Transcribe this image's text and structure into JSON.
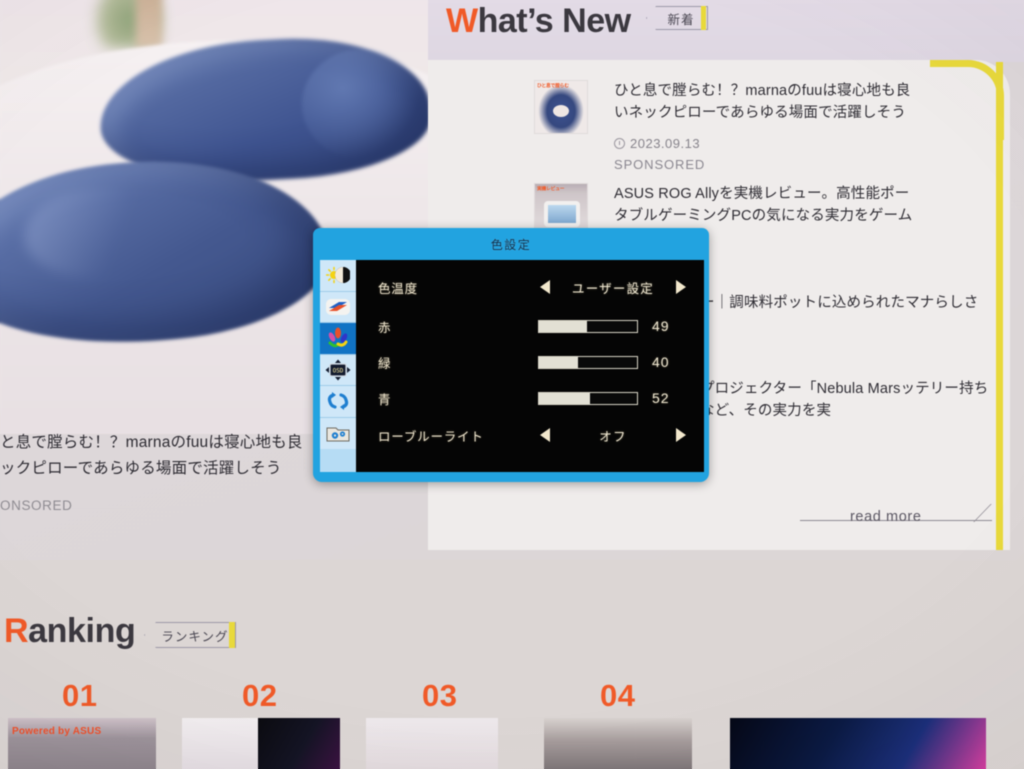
{
  "webpage": {
    "whats_new": {
      "title_accent": "W",
      "title_rest": "hat’s New",
      "badge": "新着",
      "articles": [
        {
          "title": "ひと息で膛らむ！？marnaのfuuは寝心地も良いネックピローであらゆる場面で活躍しそう",
          "date": "2023.09.13",
          "sponsored": "SPONSORED",
          "thumb_label": "ひと息で膛らむ",
          "thumb_kind": "pillow"
        },
        {
          "title": "ASUS ROG Allyを実機レビュー。高性能ポータブルゲーミングPCの気になる実力をゲームで検証",
          "date": "",
          "sponsored": "",
          "thumb_label": "実機レビュー",
          "thumb_kind": "ally"
        },
        {
          "title": "ー｜調味料ポットに込められたマナらしさ",
          "date": "",
          "sponsored": "",
          "thumb_label": "",
          "thumb_kind": "none"
        },
        {
          "title": "プロジェクター「Nebula Marsッテリー持ちなど、その実力を実",
          "date": "",
          "sponsored": "",
          "thumb_label": "",
          "thumb_kind": "none"
        }
      ],
      "read_more": "read more"
    },
    "left_article": {
      "line1": "と息で膛らむ！？marnaのfuuは寝心地も良",
      "line2": "ックピローであらゆる場面で活躍しそう",
      "sponsored": "ONSORED"
    },
    "ranking": {
      "title_accent": "R",
      "title_rest": "anking",
      "badge": "ランキング",
      "items": [
        {
          "number": "01",
          "thumb_label": "Powered by ASUS"
        },
        {
          "number": "02",
          "thumb_label": ""
        },
        {
          "number": "03",
          "thumb_label": ""
        },
        {
          "number": "04",
          "thumb_label": ""
        }
      ]
    },
    "colors": {
      "accent_orange": "#f05a28",
      "accent_yellow": "#e8d93b",
      "text_dark": "#2f2d34"
    }
  },
  "osd": {
    "title": "色設定",
    "icons": [
      {
        "name": "brightness-contrast-icon",
        "selected": false
      },
      {
        "name": "image-splendid-icon",
        "selected": false
      },
      {
        "name": "color-settings-icon",
        "selected": true
      },
      {
        "name": "osd-setup-icon",
        "selected": false
      },
      {
        "name": "system-refresh-icon",
        "selected": false
      },
      {
        "name": "menu-setup-folder-icon",
        "selected": false
      }
    ],
    "rows": [
      {
        "kind": "select",
        "label": "色温度",
        "value": "ユーザー設定",
        "left_arrow": "◀",
        "right_arrow": "▶"
      },
      {
        "kind": "slider",
        "label": "赤",
        "value": "49",
        "percent": 49
      },
      {
        "kind": "slider",
        "label": "緑",
        "value": "40",
        "percent": 40
      },
      {
        "kind": "slider",
        "label": "青",
        "value": "52",
        "percent": 52
      },
      {
        "kind": "select",
        "label": "ローブルーライト",
        "value": "オフ",
        "left_arrow": "◀",
        "right_arrow": "▶"
      }
    ],
    "colors": {
      "frame": "#22a3e0",
      "content_bg": "#050505",
      "text": "#f0e8d2",
      "selected_icon_bg": "#1173c4"
    }
  }
}
